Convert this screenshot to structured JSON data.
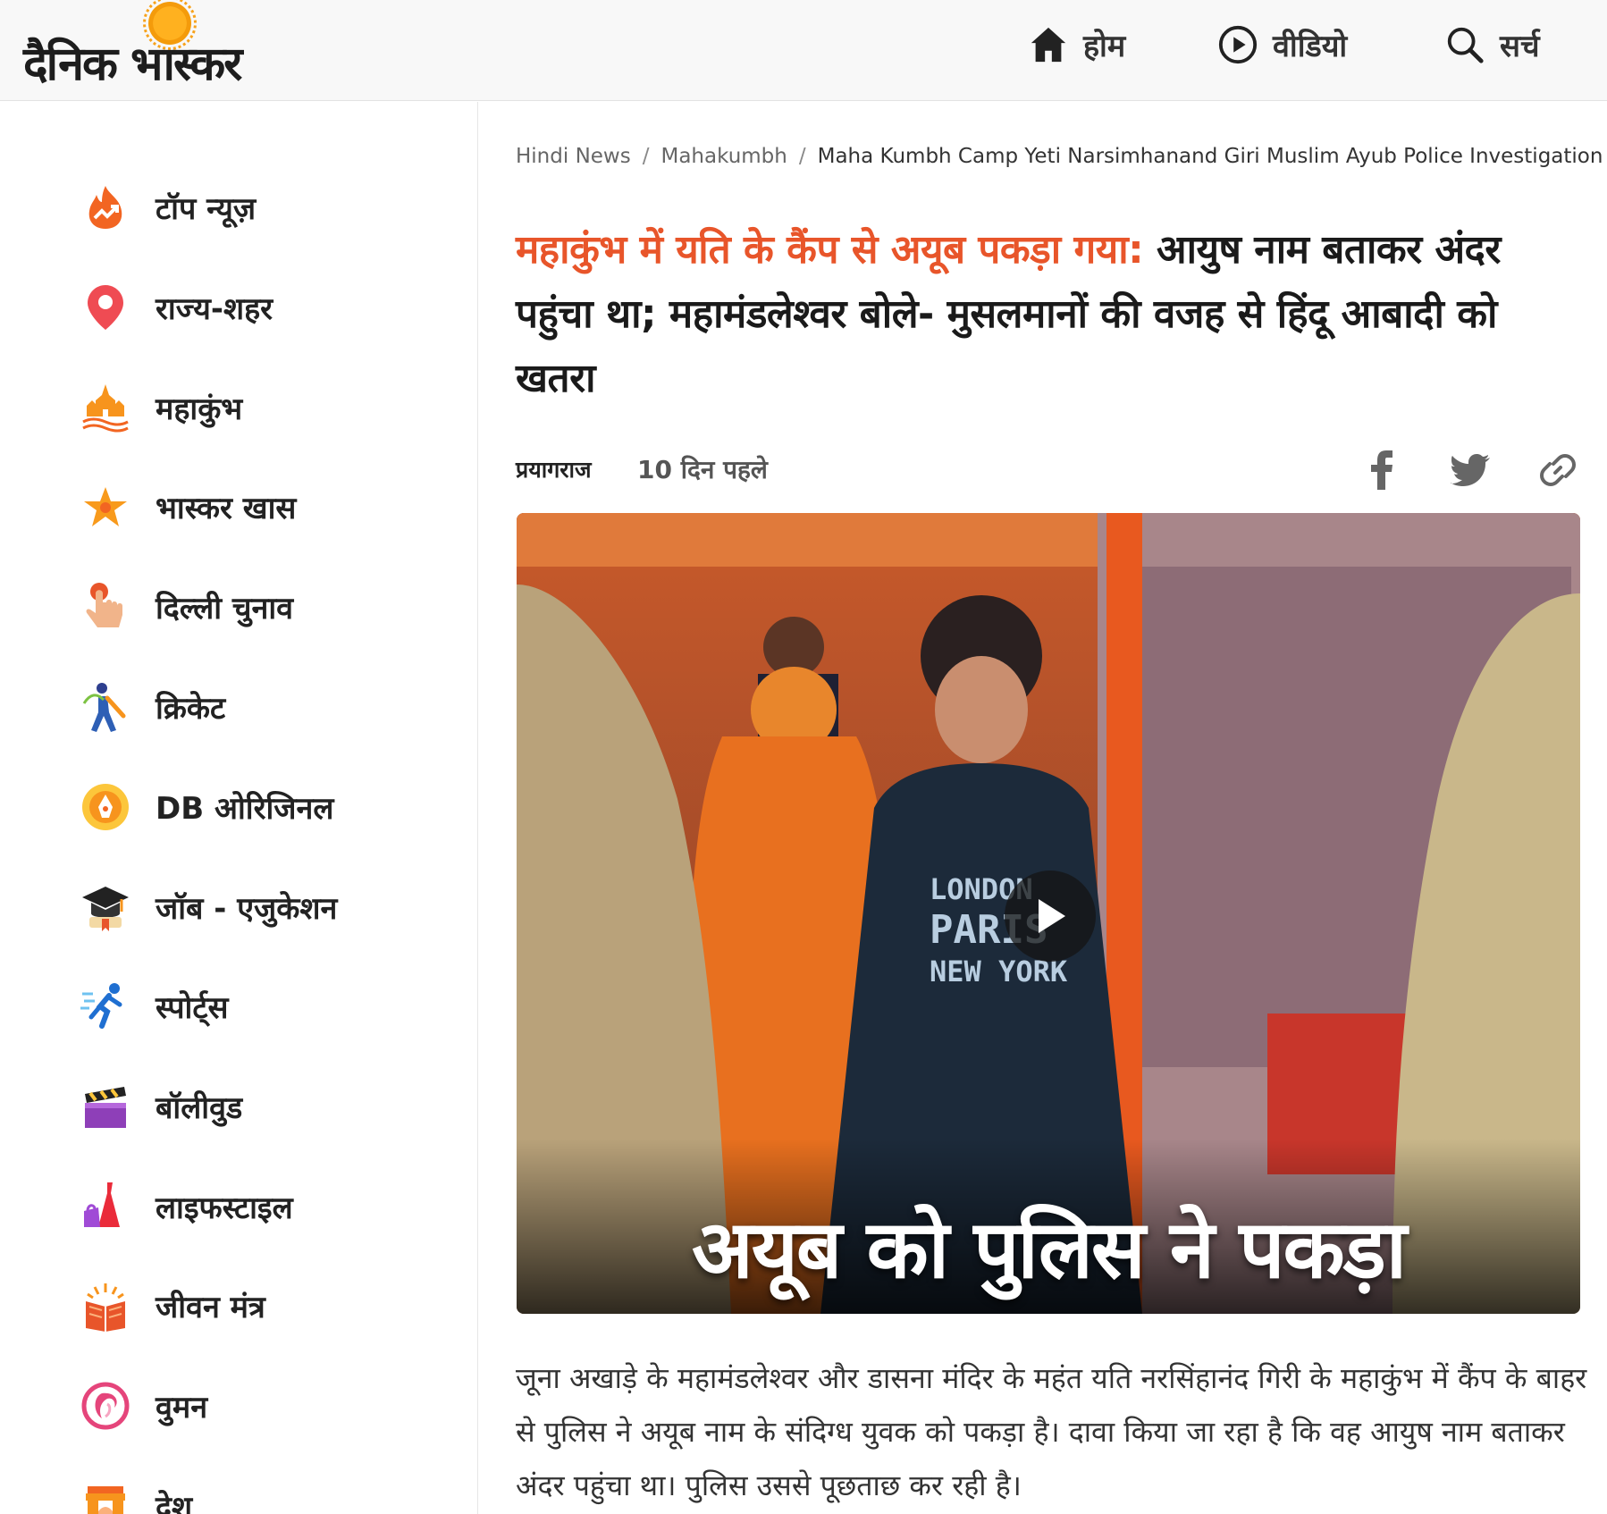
{
  "brand": {
    "logo_text": "दैनिक भास्कर"
  },
  "nav": {
    "home": {
      "label": "होम",
      "icon": "home-icon"
    },
    "video": {
      "label": "वीडियो",
      "icon": "play-circle-icon"
    },
    "search": {
      "label": "सर्च",
      "icon": "search-icon"
    }
  },
  "sidebar": {
    "items": [
      {
        "label": "टॉप न्यूज़",
        "icon": "fire-trend-icon"
      },
      {
        "label": "राज्य-शहर",
        "icon": "location-pin-icon"
      },
      {
        "label": "महाकुंभ",
        "icon": "temple-icon"
      },
      {
        "label": "भास्कर खास",
        "icon": "star-icon"
      },
      {
        "label": "दिल्ली चुनाव",
        "icon": "vote-finger-icon"
      },
      {
        "label": "क्रिकेट",
        "icon": "cricket-player-icon"
      },
      {
        "label": "DB ओरिजिनल",
        "icon": "pen-nib-icon"
      },
      {
        "label": "जॉब - एजुकेशन",
        "icon": "graduation-cap-icon"
      },
      {
        "label": "स्पोर्ट्स",
        "icon": "runner-icon"
      },
      {
        "label": "बॉलीवुड",
        "icon": "clapperboard-icon"
      },
      {
        "label": "लाइफस्टाइल",
        "icon": "dress-icon"
      },
      {
        "label": "जीवन मंत्र",
        "icon": "book-icon"
      },
      {
        "label": "वुमन",
        "icon": "woman-icon"
      },
      {
        "label": "देश",
        "icon": "india-gate-icon"
      }
    ]
  },
  "breadcrumb": {
    "items": [
      "Hindi News",
      "Mahakumbh"
    ],
    "separator": "/",
    "current": "Maha Kumbh Camp Yeti Narsimhanand Giri Muslim Ayub Police Investigation"
  },
  "article": {
    "headline_highlight": "महाकुंभ में यति के कैंप से अयूब पकड़ा गया:",
    "headline_rest": " आयुष नाम बताकर अंदर पहुंचा था; महामंडलेश्वर बोले- मुसलमानों की वजह से हिंदू आबादी को खतरा",
    "location": "प्रयागराज",
    "time": "10 दिन पहले",
    "video_caption": "अयूब को पुलिस ने पकड़ा",
    "shirt_text": [
      "LONDON",
      "PARIS",
      "NEW YORK"
    ],
    "body": "जूना अखाड़े के महामंडलेश्वर और डासना मंदिर के महंत यति नरसिंहानंद गिरी के महाकुंभ में कैंप के बाहर से पुलिस ने अयूब नाम के संदिग्ध युवक को पकड़ा है। दावा किया जा रहा है कि वह आयुष नाम बताकर अंदर पहुंचा था। पुलिस उससे पूछताछ कर रही है।"
  },
  "colors": {
    "accent": "#e8552a",
    "header_bg": "#f8f8f8",
    "text": "#222222"
  }
}
